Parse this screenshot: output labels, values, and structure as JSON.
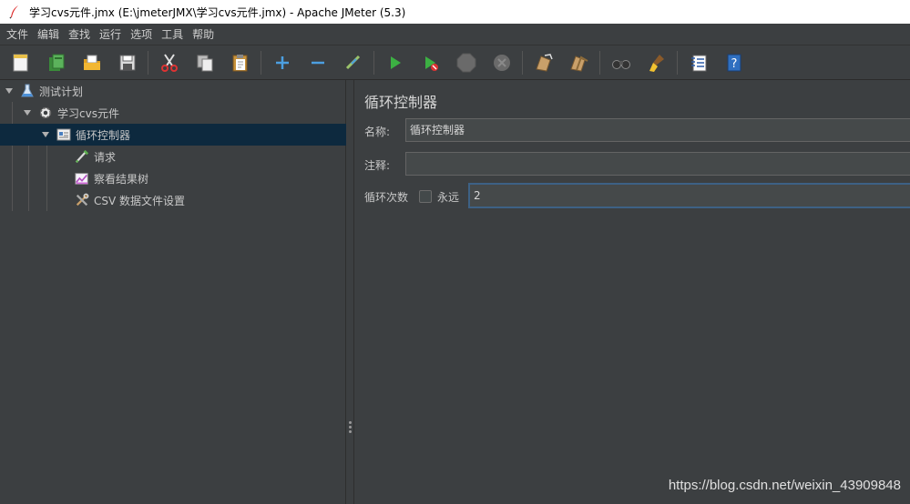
{
  "window": {
    "title": "学习cvs元件.jmx (E:\\jmeterJMX\\学习cvs元件.jmx) - Apache JMeter (5.3)"
  },
  "menu": [
    "文件",
    "编辑",
    "查找",
    "运行",
    "选项",
    "工具",
    "帮助"
  ],
  "toolbar": {
    "icons": [
      "new-icon",
      "templates-icon",
      "open-icon",
      "save-icon",
      "cut-icon",
      "copy-icon",
      "paste-icon",
      "add-icon",
      "remove-icon",
      "toggle-icon",
      "start-icon",
      "start-no-pause-icon",
      "stop-icon",
      "shutdown-icon",
      "clear-icon",
      "clear-all-icon",
      "search-icon",
      "reset-search-icon",
      "function-helper-icon",
      "help-icon"
    ]
  },
  "tree": {
    "items": [
      {
        "label": "测试计划",
        "icon": "test-plan-icon"
      },
      {
        "label": "学习cvs元件",
        "icon": "thread-group-icon"
      },
      {
        "label": "循环控制器",
        "icon": "loop-controller-icon"
      },
      {
        "label": "请求",
        "icon": "sampler-icon"
      },
      {
        "label": "察看结果树",
        "icon": "listener-icon"
      },
      {
        "label": "CSV 数据文件设置",
        "icon": "config-icon"
      }
    ]
  },
  "panel": {
    "title": "循环控制器",
    "name_label": "名称:",
    "name_value": "循环控制器",
    "comment_label": "注释:",
    "comment_value": "",
    "loop_label": "循环次数",
    "forever_label": "永远",
    "forever_checked": false,
    "loop_value": "2"
  },
  "watermark": "https://blog.csdn.net/weixin_43909848"
}
